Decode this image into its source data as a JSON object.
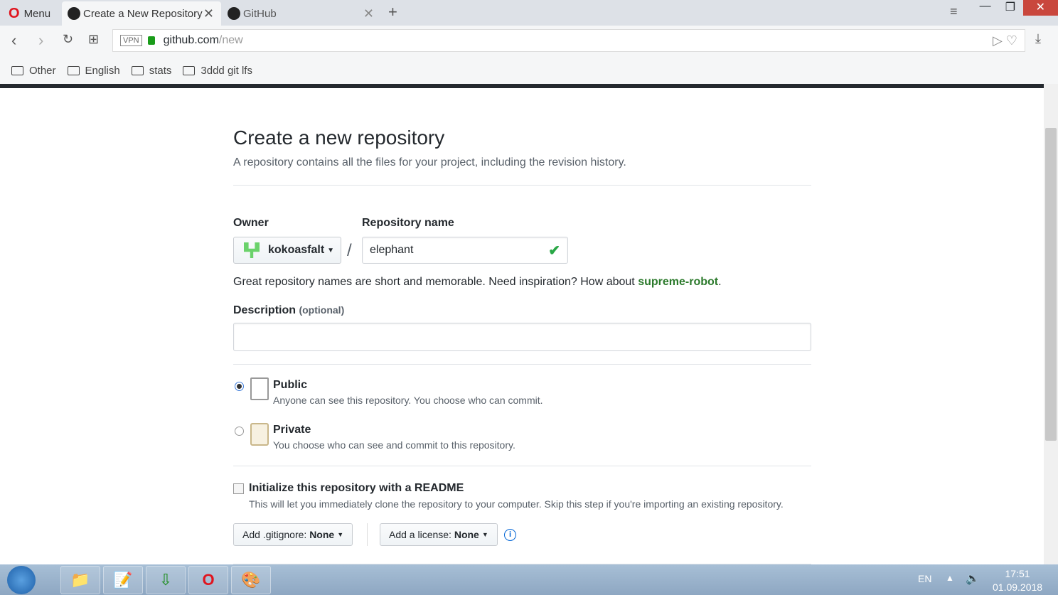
{
  "browser": {
    "menu_label": "Menu",
    "tabs": [
      {
        "title": "Create a New Repository"
      },
      {
        "title": "GitHub"
      }
    ],
    "vpn": "VPN",
    "url_host": "github.com",
    "url_path": "/new",
    "bookmarks": [
      "Other",
      "English",
      "stats",
      "3ddd git lfs"
    ]
  },
  "page": {
    "title": "Create a new repository",
    "subtitle": "A repository contains all the files for your project, including the revision history.",
    "owner_label": "Owner",
    "owner_value": "kokoasfalt",
    "repo_label": "Repository name",
    "repo_value": "elephant",
    "separator": "/",
    "hint_text": "Great repository names are short and memorable. Need inspiration? How about ",
    "hint_suggestion": "supreme-robot",
    "hint_end": ".",
    "desc_label": "Description",
    "desc_optional": "(optional)",
    "desc_value": "",
    "visibility": [
      {
        "label": "Public",
        "desc": "Anyone can see this repository. You choose who can commit.",
        "selected": true
      },
      {
        "label": "Private",
        "desc": "You choose who can see and commit to this repository.",
        "selected": false
      }
    ],
    "readme_label": "Initialize this repository with a README",
    "readme_desc": "This will let you immediately clone the repository to your computer. Skip this step if you're importing an existing repository.",
    "readme_checked": false,
    "gitignore_label": "Add .gitignore:",
    "gitignore_value": "None",
    "license_label": "Add a license:",
    "license_value": "None"
  },
  "taskbar": {
    "lang": "EN",
    "time": "17:51",
    "date": "01.09.2018"
  },
  "colors": {
    "accent_green": "#28a745",
    "suggestion": "#2c7a2c"
  }
}
